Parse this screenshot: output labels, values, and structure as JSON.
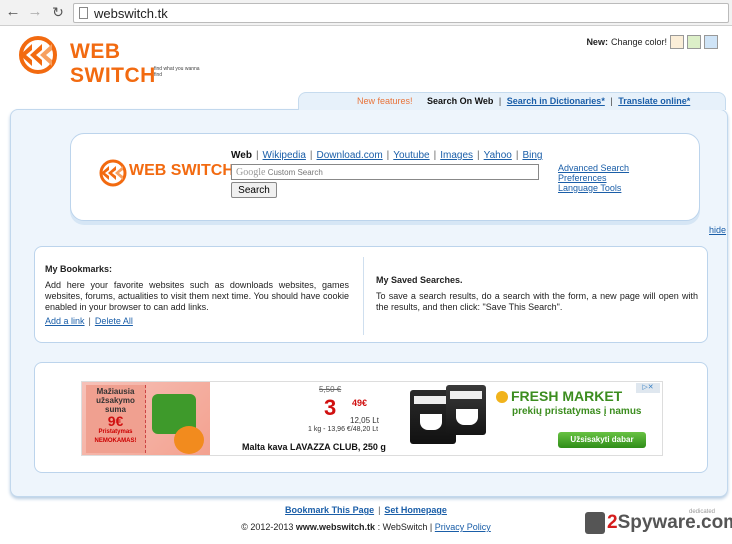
{
  "browser": {
    "url": "webswitch.tk"
  },
  "header": {
    "logo_text": "WEB SWITCH",
    "logo_tagline": "find what you wanna find",
    "color_label_bold": "New:",
    "color_label": "Change color!",
    "swatch_colors": [
      "#fbeed8",
      "#dcefc8",
      "#cfe4f7"
    ]
  },
  "tabs": {
    "new_label": "New features!",
    "active": "Search On Web",
    "items": [
      "Search in Dictionaries*",
      "Translate online*"
    ]
  },
  "search": {
    "logo_text": "WEB SWITCH",
    "engine_active": "Web",
    "engines": [
      "Wikipedia",
      "Download.com",
      "Youtube",
      "Images",
      "Yahoo",
      "Bing"
    ],
    "google_mark": "Google",
    "placeholder": "Custom Search",
    "button_label": "Search",
    "side_links": [
      "Advanced Search",
      "Preferences",
      "Language Tools"
    ],
    "hide_label": "hide"
  },
  "bookmarks": {
    "title": "My Bookmarks:",
    "text": "Add here your favorite websites such as downloads websites, games websites, forums, actualities to visit them next time. You should have cookie enabled in your browser to can add links.",
    "add_link": "Add a link",
    "delete_all": "Delete All"
  },
  "saved": {
    "title": "My Saved Searches.",
    "text": "To save a search results, do a search with the form, a new page will open with the results, and then click: \"Save This Search\"."
  },
  "ad": {
    "promo_title": "Mažiausia užsakymo suma",
    "promo_price": "9€",
    "promo_small": "Pristatymas NEMOKAMAS!",
    "old_price": "5,50 €",
    "new_price_whole": "3",
    "new_price_cents": "49€",
    "price_lt": "12,05 Lt",
    "unit_price": "1 kg - 13,96 €/48,20 Lt",
    "product_name": "Malta kava LAVAZZA CLUB, 250 g",
    "brand": "FRESH MARKET",
    "tagline": "prekių pristatymas į namus",
    "cta": "Užsisakyti dabar",
    "choices": "▷✕"
  },
  "footer": {
    "bookmark_link": "Bookmark This Page",
    "homepage_link": "Set Homepage",
    "copyright_prefix": "© 2012-2013",
    "domain": "www.webswitch.tk",
    "copyright_suffix": ": WebSwitch |",
    "privacy_link": "Privacy Policy"
  },
  "watermark": {
    "prefix": "2",
    "main": "Spyware",
    "suffix": ".com",
    "sub": "dedicated"
  }
}
